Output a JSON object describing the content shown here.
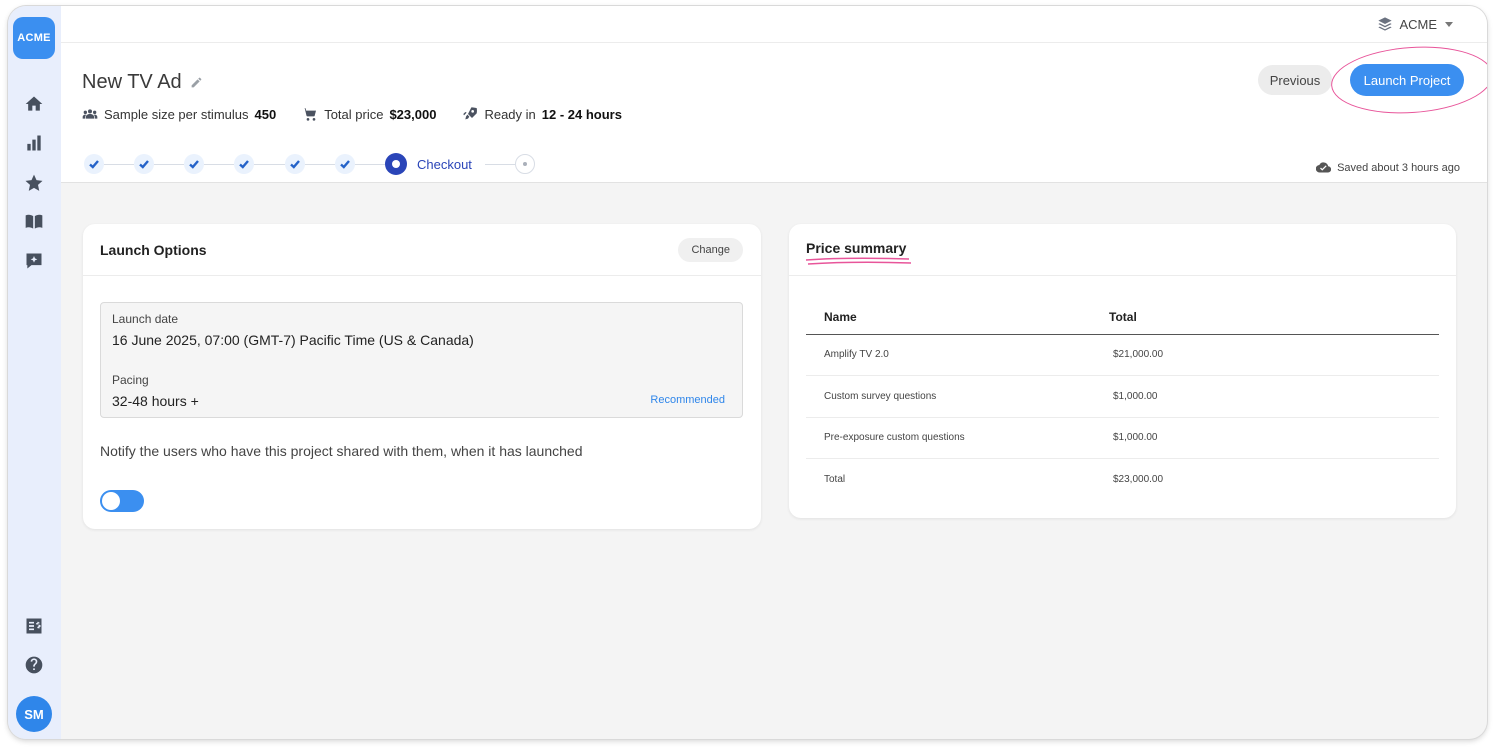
{
  "app": {
    "logo": "ACME",
    "org_name": "ACME",
    "avatar_initials": "SM"
  },
  "project": {
    "title": "New TV Ad",
    "sample_label": "Sample size per stimulus",
    "sample_value": "450",
    "price_label": "Total price",
    "price_value": "$23,000",
    "ready_label": "Ready in",
    "ready_value": "12 - 24 hours"
  },
  "actions": {
    "previous": "Previous",
    "launch": "Launch Project"
  },
  "stepper": {
    "current_label": "Checkout",
    "completed_steps": 6
  },
  "saved_status": "Saved about 3 hours ago",
  "launch_options": {
    "title": "Launch Options",
    "change": "Change",
    "launch_date_label": "Launch date",
    "launch_date_value": "16 June 2025, 07:00 (GMT-7) Pacific Time (US & Canada)",
    "pacing_label": "Pacing",
    "pacing_value": "32-48 hours +",
    "recommended": "Recommended",
    "notify_text": "Notify the users who have this project shared with them, when it has launched"
  },
  "price_summary": {
    "title": "Price summary",
    "headers": [
      "Name",
      "Total"
    ],
    "rows": [
      [
        "Amplify TV 2.0",
        "$21,000.00"
      ],
      [
        "Custom survey questions",
        "$1,000.00"
      ],
      [
        "Pre-exposure custom questions",
        "$1,000.00"
      ],
      [
        "Total",
        "$23,000.00"
      ]
    ]
  },
  "colors": {
    "accent": "#3b8ff0",
    "stepper": "#2a45b8",
    "annotation": "#e8559a"
  }
}
